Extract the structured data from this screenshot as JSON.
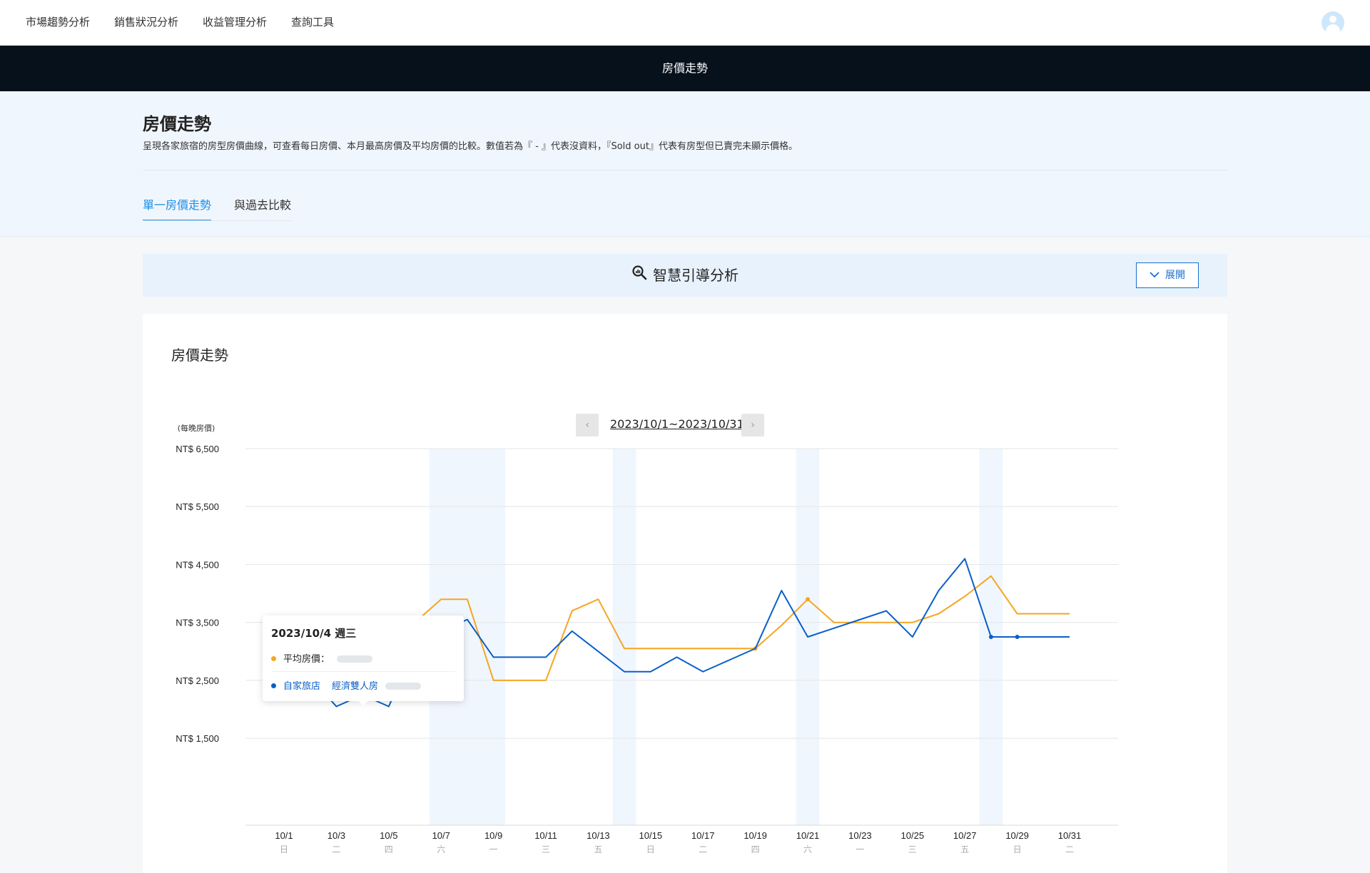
{
  "nav": {
    "tabs": [
      {
        "label": "市場趨勢分析",
        "active": true
      },
      {
        "label": "銷售狀況分析",
        "active": false
      },
      {
        "label": "收益管理分析",
        "active": false
      },
      {
        "label": "查詢工具",
        "active": false
      }
    ]
  },
  "page_bar": {
    "title": "房價走勢"
  },
  "header": {
    "title": "房價走勢",
    "description": "呈現各家旅宿的房型房價曲線，可查看每日房價、本月最高房價及平均房價的比較。數值若為『 - 』代表沒資料，『Sold out』代表有房型但已賣完未顯示價格。",
    "subtabs": [
      {
        "label": "單一房價走勢",
        "active": true
      },
      {
        "label": "與過去比較",
        "active": false
      }
    ]
  },
  "smart_banner": {
    "title": "智慧引導分析",
    "expand_label": "展開"
  },
  "card": {
    "title": "房價走勢"
  },
  "date_nav": {
    "range": "2023/10/1~2023/10/31",
    "prev_symbol": "‹",
    "next_symbol": "›"
  },
  "tooltip": {
    "date": "2023/10/4  週三",
    "avg_label": "平均房價：",
    "hotel_label": "自家旅店",
    "room_label": "經濟雙人房"
  },
  "colors": {
    "avg": "#f5a623",
    "hotel": "#0a5fc7",
    "weekend_band": "#f0f6fd",
    "grid": "#e5e5e5"
  },
  "chart_data": {
    "type": "line",
    "ylabel": "(每晚房價)",
    "ylim": [
      0,
      6500
    ],
    "yticks": [
      1500,
      2500,
      3500,
      4500,
      5500,
      6500
    ],
    "ytick_labels": [
      "NT$ 1,500",
      "NT$ 2,500",
      "NT$ 3,500",
      "NT$ 4,500",
      "NT$ 5,500",
      "NT$ 6,500"
    ],
    "x": [
      1,
      2,
      3,
      4,
      5,
      6,
      7,
      8,
      9,
      10,
      11,
      12,
      13,
      14,
      15,
      16,
      17,
      18,
      19,
      20,
      21,
      22,
      23,
      24,
      25,
      26,
      27,
      28,
      29,
      30,
      31
    ],
    "x_tick_days": [
      1,
      3,
      5,
      7,
      9,
      11,
      13,
      15,
      17,
      19,
      21,
      23,
      25,
      27,
      29,
      31
    ],
    "x_tick_labels": [
      "10/1",
      "10/3",
      "10/5",
      "10/7",
      "10/9",
      "10/11",
      "10/13",
      "10/15",
      "10/17",
      "10/19",
      "10/21",
      "10/23",
      "10/25",
      "10/27",
      "10/29",
      "10/31"
    ],
    "x_tick_weekdays": [
      "日",
      "二",
      "四",
      "六",
      "一",
      "三",
      "五",
      "日",
      "二",
      "四",
      "六",
      "一",
      "三",
      "五",
      "日",
      "二"
    ],
    "highlight_days": [
      [
        7,
        9
      ],
      [
        14,
        14
      ],
      [
        21,
        21
      ],
      [
        28,
        28
      ]
    ],
    "series": [
      {
        "name": "平均房價",
        "values": [
          2750,
          2600,
          2600,
          2500,
          3250,
          3500,
          3900,
          3900,
          2500,
          2500,
          2500,
          3700,
          3900,
          3050,
          3050,
          3050,
          3050,
          3050,
          3050,
          3450,
          3900,
          3500,
          3500,
          3500,
          3500,
          3650,
          3950,
          4300,
          3650,
          3650,
          3650
        ],
        "marker_days": [
          19,
          21
        ]
      },
      {
        "name": "自家旅店 經濟雙人房",
        "values": [
          2700,
          2550,
          2050,
          2250,
          2050,
          3050,
          3350,
          3550,
          2900,
          2900,
          2900,
          3350,
          3000,
          2650,
          2650,
          2900,
          2650,
          2850,
          3050,
          4050,
          3250,
          3400,
          3550,
          3700,
          3250,
          4050,
          4600,
          3250,
          3250,
          3250,
          3250
        ],
        "marker_days": [
          28,
          29
        ]
      }
    ]
  }
}
